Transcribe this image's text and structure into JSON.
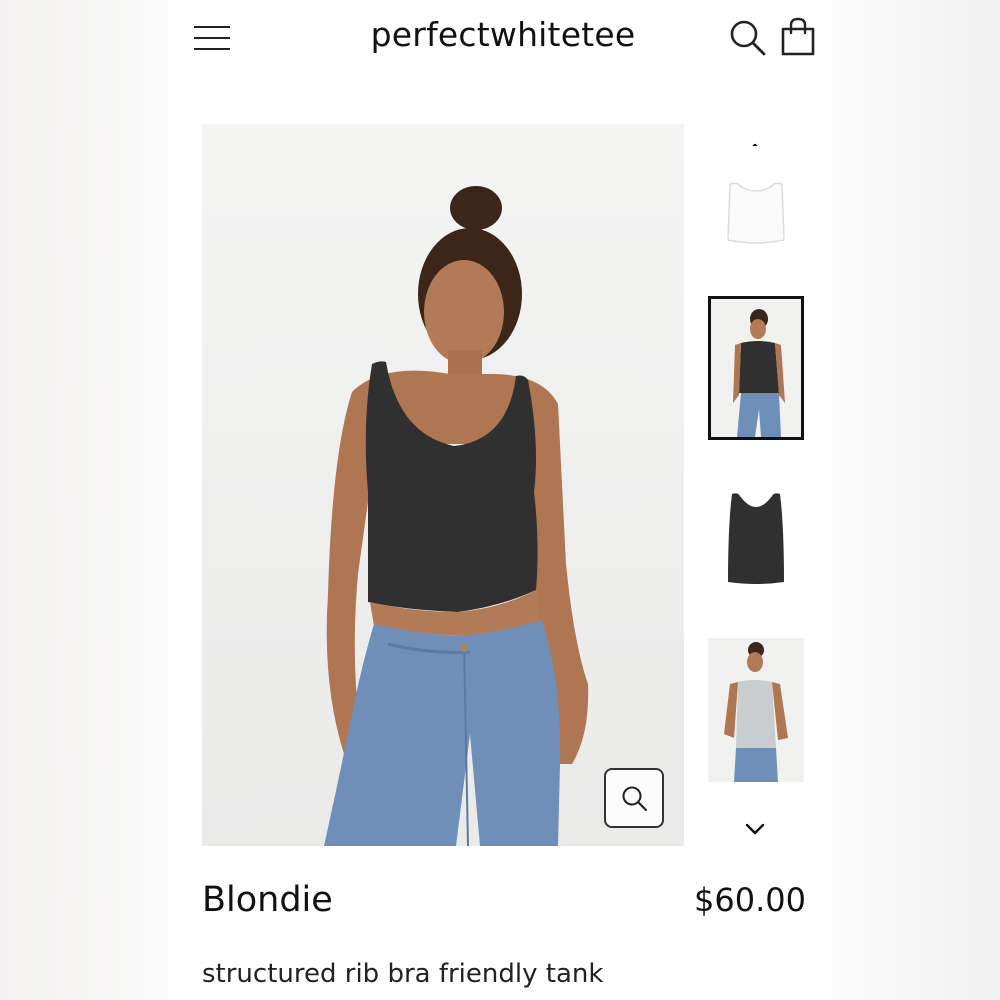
{
  "header": {
    "brand": "perfectwhitetee",
    "menu_icon": "hamburger-menu-icon",
    "search_icon": "search-icon",
    "cart_icon": "shopping-bag-icon"
  },
  "gallery": {
    "main_image_alt": "model wearing black rib tank with blue jeans",
    "zoom_icon": "zoom-icon",
    "thumbnails": [
      {
        "alt": "white tank flat lay",
        "selected": false
      },
      {
        "alt": "model in black tank",
        "selected": true
      },
      {
        "alt": "black tank flat lay",
        "selected": false
      },
      {
        "alt": "model in grey tank",
        "selected": false
      }
    ],
    "up_icon": "chevron-up-icon",
    "down_icon": "chevron-down-icon"
  },
  "product": {
    "name": "Blondie",
    "price": "$60.00",
    "description": "structured rib bra friendly tank"
  },
  "colors": {
    "text": "#111111",
    "background": "#ffffff",
    "tank_black": "#2f302f",
    "denim": "#6f8fb9"
  }
}
